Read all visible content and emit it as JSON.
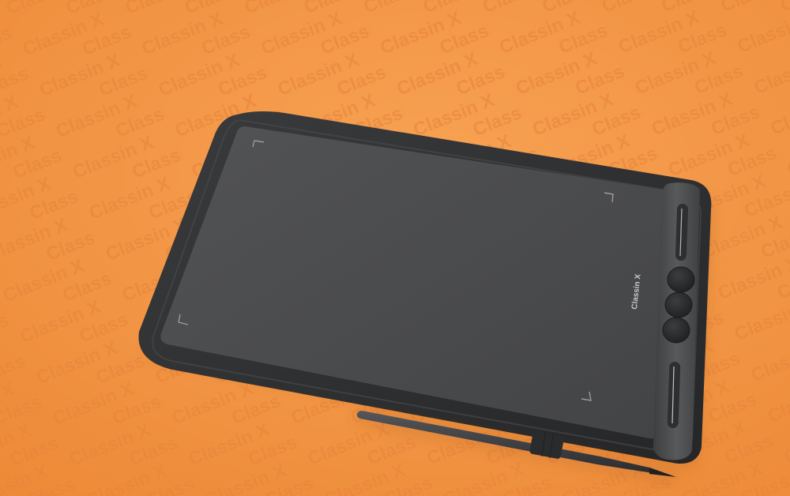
{
  "scene": {
    "subject": "drawing tablet with stylus",
    "brand_mark": "Classin X",
    "background_pattern_text": "Classin X",
    "colors": {
      "background": "#f2913e",
      "background_pattern": "#e9823a",
      "tablet_body": "#2f3032",
      "active_area": "#4a4b4d",
      "express_key_strip": "#4b4c4e",
      "button": "#2a2b2d",
      "stylus": "#3a3b3d"
    },
    "express_keys": {
      "button_count": 3,
      "touch_strip_count": 2
    }
  }
}
